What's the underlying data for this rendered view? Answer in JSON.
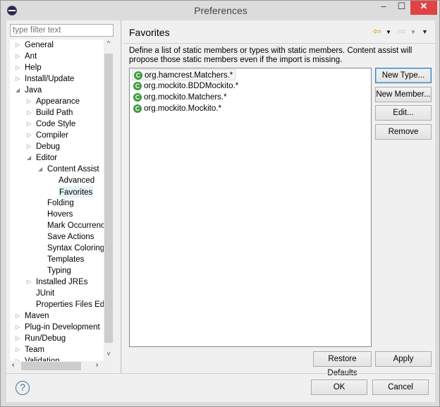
{
  "window": {
    "title": "Preferences",
    "minimize": "–",
    "maximize": "☐",
    "close": "✕"
  },
  "sidebar": {
    "filter_placeholder": "type filter text",
    "items": [
      {
        "label": "General",
        "level": 0,
        "expandable": true
      },
      {
        "label": "Ant",
        "level": 0,
        "expandable": true
      },
      {
        "label": "Help",
        "level": 0,
        "expandable": true
      },
      {
        "label": "Install/Update",
        "level": 0,
        "expandable": true
      },
      {
        "label": "Java",
        "level": 0,
        "expanded": true
      },
      {
        "label": "Appearance",
        "level": 1,
        "expandable": true
      },
      {
        "label": "Build Path",
        "level": 1,
        "expandable": true
      },
      {
        "label": "Code Style",
        "level": 1,
        "expandable": true
      },
      {
        "label": "Compiler",
        "level": 1,
        "expandable": true
      },
      {
        "label": "Debug",
        "level": 1,
        "expandable": true
      },
      {
        "label": "Editor",
        "level": 1,
        "expanded": true
      },
      {
        "label": "Content Assist",
        "level": 2,
        "expanded": true
      },
      {
        "label": "Advanced",
        "level": 3
      },
      {
        "label": "Favorites",
        "level": 3,
        "selected": true
      },
      {
        "label": "Folding",
        "level": 2
      },
      {
        "label": "Hovers",
        "level": 2
      },
      {
        "label": "Mark Occurrences",
        "level": 2
      },
      {
        "label": "Save Actions",
        "level": 2
      },
      {
        "label": "Syntax Coloring",
        "level": 2
      },
      {
        "label": "Templates",
        "level": 2
      },
      {
        "label": "Typing",
        "level": 2
      },
      {
        "label": "Installed JREs",
        "level": 1,
        "expandable": true
      },
      {
        "label": "JUnit",
        "level": 1
      },
      {
        "label": "Properties Files Editor",
        "level": 1
      },
      {
        "label": "Maven",
        "level": 0,
        "expandable": true
      },
      {
        "label": "Plug-in Development",
        "level": 0,
        "expandable": true
      },
      {
        "label": "Run/Debug",
        "level": 0,
        "expandable": true
      },
      {
        "label": "Team",
        "level": 0,
        "expandable": true
      },
      {
        "label": "Validation",
        "level": 0,
        "expandable": true
      }
    ]
  },
  "main": {
    "title": "Favorites",
    "description": "Define a list of static members or types with static members. Content assist will propose those static members even if the import is missing.",
    "favorites": [
      "org.hamcrest.Matchers.*",
      "org.mockito.BDDMockito.*",
      "org.mockito.Matchers.*",
      "org.mockito.Mockito.*"
    ],
    "buttons": {
      "new_type": "New Type...",
      "new_member": "New Member...",
      "edit": "Edit...",
      "remove": "Remove",
      "restore_defaults": "Restore Defaults",
      "apply": "Apply"
    }
  },
  "footer": {
    "help": "?",
    "ok": "OK",
    "cancel": "Cancel"
  },
  "colors": {
    "close_button": "#e04343",
    "favorite_icon": "#3c9a3c",
    "selection": "#e5f3fb"
  }
}
